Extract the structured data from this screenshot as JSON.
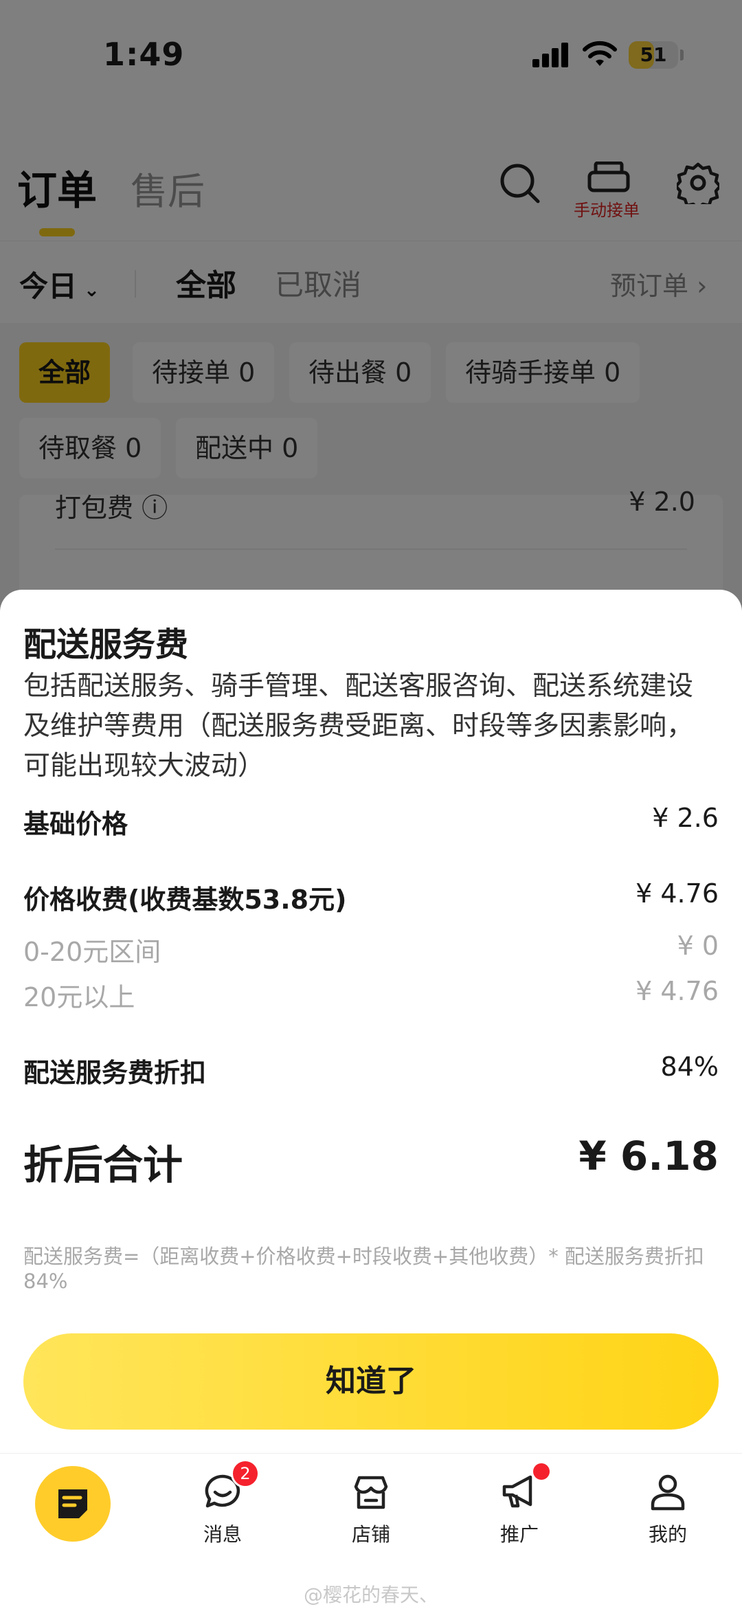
{
  "status_bar": {
    "time": "1:49",
    "battery": "51",
    "battery_level": 0.51
  },
  "header": {
    "tabs": [
      "订单",
      "售后"
    ],
    "manual_accept_label": "手动接单",
    "icons": [
      "search-icon",
      "printer-icon",
      "gear-icon"
    ]
  },
  "filter": {
    "date": "今日",
    "segments": [
      "全部",
      "已取消"
    ],
    "preorder": "预订单 ›"
  },
  "chips": [
    "全部",
    "待接单 0",
    "待出餐 0",
    "待骑手接单 0",
    "待取餐 0",
    "配送中 0"
  ],
  "card_peek": {
    "label": "打包费",
    "value": "¥ 2.0"
  },
  "sheet": {
    "title": "配送服务费",
    "description": "包括配送服务、骑手管理、配送客服咨询、配送系统建设及维护等费用（配送服务费受距离、时段等多因素影响，可能出现较大波动）",
    "base_price": {
      "label": "基础价格",
      "value": "¥ 2.6"
    },
    "price_fee": {
      "label": "价格收费(收费基数53.8元)",
      "value": "¥ 4.76"
    },
    "tiers": [
      {
        "label": "0-20元区间",
        "value": "¥ 0"
      },
      {
        "label": "20元以上",
        "value": "¥ 4.76"
      }
    ],
    "discount": {
      "label": "配送服务费折扣",
      "value": "84%"
    },
    "total": {
      "label": "折后合计",
      "value": "¥ 6.18"
    },
    "formula": "配送服务费=（距离收费+价格收费+时段收费+其他收费）* 配送服务费折扣 84%",
    "ok_button": "知道了"
  },
  "tabbar": {
    "items": [
      "",
      "消息",
      "店铺",
      "推广",
      "我的"
    ],
    "message_badge": "2"
  },
  "watermark": "@樱花的春天、",
  "colors": {
    "accent": "#ffd21f",
    "badge": "#f5222d"
  }
}
